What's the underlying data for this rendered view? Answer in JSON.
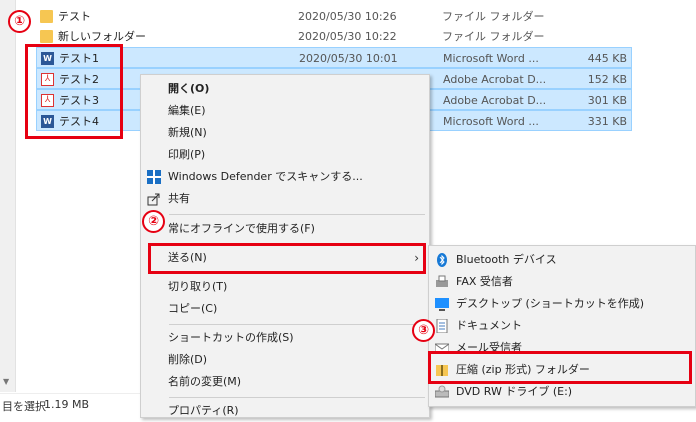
{
  "files": [
    {
      "name": "テスト",
      "date": "2020/05/30 10:26",
      "type": "ファイル フォルダー",
      "size": "",
      "icon": "folder-icon",
      "selected": false
    },
    {
      "name": "新しいフォルダー",
      "date": "2020/05/30 10:22",
      "type": "ファイル フォルダー",
      "size": "",
      "icon": "folder-icon",
      "selected": false
    },
    {
      "name": "テスト1",
      "date": "2020/05/30 10:01",
      "type": "Microsoft Word ...",
      "size": "445 KB",
      "icon": "word-icon",
      "selected": true
    },
    {
      "name": "テスト2",
      "date": "",
      "type": "Adobe Acrobat D...",
      "size": "152 KB",
      "icon": "pdf-icon",
      "selected": true
    },
    {
      "name": "テスト3",
      "date": "",
      "type": "Adobe Acrobat D...",
      "size": "301 KB",
      "icon": "pdf-icon",
      "selected": true
    },
    {
      "name": "テスト4",
      "date": "",
      "type": "Microsoft Word ...",
      "size": "331 KB",
      "icon": "word-icon",
      "selected": true
    }
  ],
  "status": {
    "selection": "目を選択",
    "size": "1.19 MB"
  },
  "context_menu": {
    "open": "開く(O)",
    "edit": "編集(E)",
    "new": "新規(N)",
    "print": "印刷(P)",
    "defender": "Windows Defender でスキャンする...",
    "share": "共有",
    "offline": "常にオフラインで使用する(F)",
    "send_to": "送る(N)",
    "cut": "切り取り(T)",
    "copy": "コピー(C)",
    "shortcut": "ショートカットの作成(S)",
    "delete": "削除(D)",
    "rename": "名前の変更(M)",
    "properties": "プロパティ(R)"
  },
  "submenu": {
    "bluetooth": "Bluetooth デバイス",
    "fax": "FAX 受信者",
    "desktop": "デスクトップ (ショートカットを作成)",
    "documents": "ドキュメント",
    "mail": "メール受信者",
    "zip": "圧縮 (zip 形式) フォルダー",
    "dvd": "DVD RW ドライブ (E:)"
  },
  "annotations": {
    "one": "①",
    "two": "②",
    "three": "③"
  },
  "colors": {
    "highlight_red": "#e60012",
    "selection": "#cce8ff"
  }
}
